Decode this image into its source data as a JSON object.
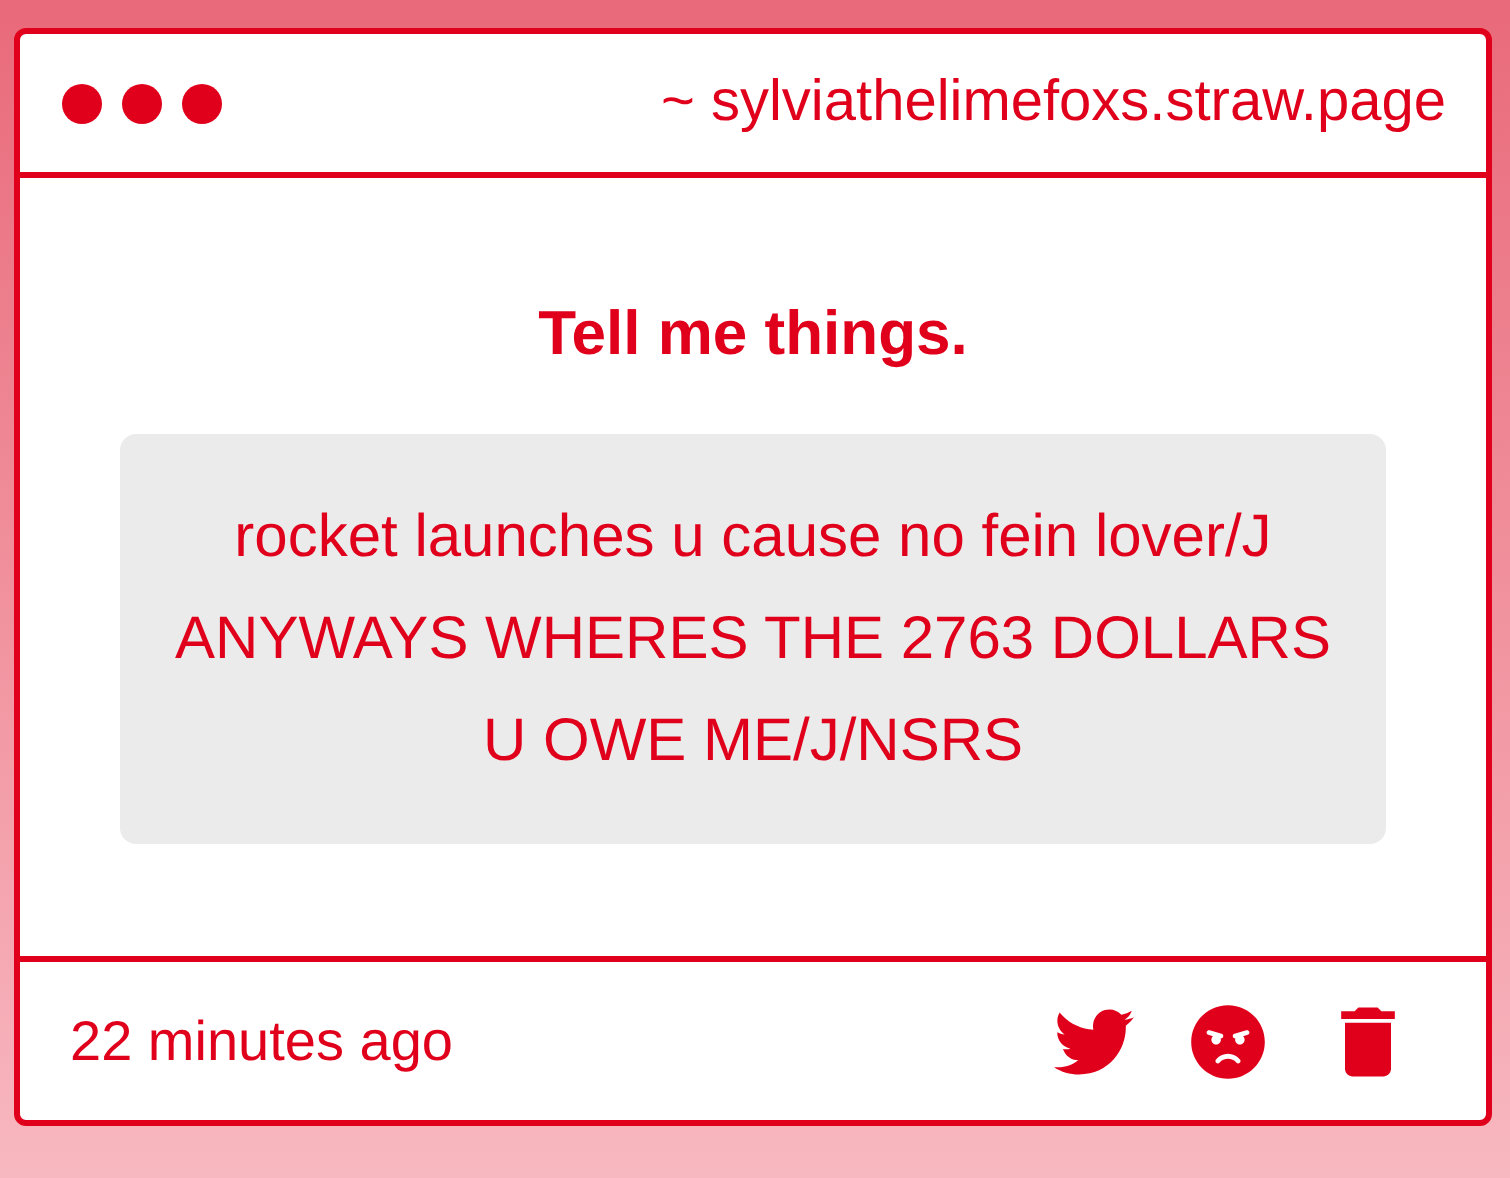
{
  "header": {
    "url": "~ sylviathelimefoxs.straw.page"
  },
  "prompt": "Tell me things.",
  "message": "rocket launches u cause no fein lover/J ANYWAYS WHERES THE 2763 DOLLARS U OWE ME/J/NSRS",
  "footer": {
    "time": "22 minutes ago",
    "actions": [
      {
        "kind": "twitter"
      },
      {
        "kind": "angry"
      },
      {
        "kind": "delete"
      }
    ]
  }
}
